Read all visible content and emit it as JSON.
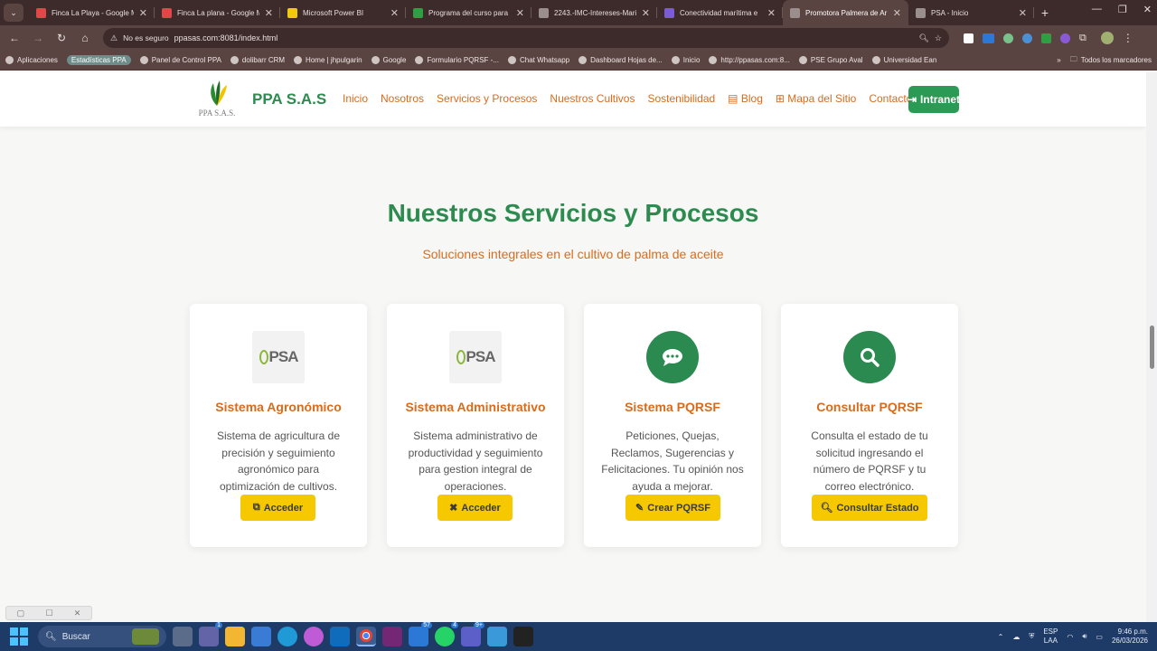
{
  "browser": {
    "tabs": [
      {
        "label": "Finca La Playa - Google M",
        "color": "#e04848"
      },
      {
        "label": "Finca La plana - Google M",
        "color": "#e04848"
      },
      {
        "label": "Microsoft Power BI",
        "color": "#f2c811"
      },
      {
        "label": "Programa del curso para I",
        "color": "#2ea043"
      },
      {
        "label": "2243.-IMC-Intereses-Mari",
        "color": "#9a8f8d"
      },
      {
        "label": "Conectividad marítima e",
        "color": "#7b5cd6"
      },
      {
        "label": "Promotora Palmera de Ar",
        "color": "#9a8f8d",
        "active": true
      },
      {
        "label": "PSA - Inicio",
        "color": "#9a8f8d"
      }
    ],
    "new_tab": "+",
    "security_label": "No es seguro",
    "url": "ppasas.com:8081/index.html",
    "bookmarks": [
      {
        "label": "Aplicaciones"
      },
      {
        "label": "Estadísticas PPA",
        "chip": true
      },
      {
        "label": "Panel de Control PPA"
      },
      {
        "label": "dolibarr CRM"
      },
      {
        "label": "Home | jhpulgarin"
      },
      {
        "label": "Google"
      },
      {
        "label": "Formulario PQRSF -..."
      },
      {
        "label": "Chat Whatsapp"
      },
      {
        "label": "Dashboard Hojas de..."
      },
      {
        "label": "Inicio"
      },
      {
        "label": "http://ppasas.com:8..."
      },
      {
        "label": "PSE Grupo Aval"
      },
      {
        "label": "Universidad Ean"
      }
    ],
    "all_bookmarks": "Todos los marcadores"
  },
  "site": {
    "logo_text": "PPA S.A.S.",
    "brand": "PPA S.A.S",
    "menu": [
      "Inicio",
      "Nosotros",
      "Servicios y Procesos",
      "Nuestros Cultivos",
      "Sostenibilidad",
      "Blog",
      "Mapa del Sitio",
      "Contacto"
    ],
    "intranet_label": "Intranet",
    "section_title": "Nuestros Servicios y Procesos",
    "section_subtitle": "Soluciones integrales en el cultivo de palma de aceite",
    "cards": [
      {
        "title": "Sistema Agronómico",
        "description": "Sistema de agricultura de precisión y seguimiento agronómico para optimización de cultivos.",
        "button": "Acceder",
        "logo_text": "PSA"
      },
      {
        "title": "Sistema Administrativo",
        "description": "Sistema administrativo de productividad y seguimiento para gestion integral de operaciones.",
        "button": "Acceder",
        "logo_text": "PSA"
      },
      {
        "title": "Sistema PQRSF",
        "description": "Peticiones, Quejas, Reclamos, Sugerencias y Felicitaciones. Tu opinión nos ayuda a mejorar.",
        "button": "Crear PQRSF"
      },
      {
        "title": "Consultar PQRSF",
        "description": "Consulta el estado de tu solicitud ingresando el número de PQRSF y tu correo electrónico.",
        "button": "Consultar Estado"
      }
    ],
    "colors": {
      "green": "#2e8b4f",
      "orange": "#d96b1c",
      "yellow": "#f5c800"
    }
  },
  "taskbar": {
    "search_label": "Buscar",
    "badges": {
      "teams": "1",
      "mail": "57",
      "whatsapp": "4",
      "app": "9+"
    },
    "lang_top": "ESP",
    "lang_bottom": "LAA",
    "time": "9:46 p.m.",
    "date": "26/03/2026"
  }
}
